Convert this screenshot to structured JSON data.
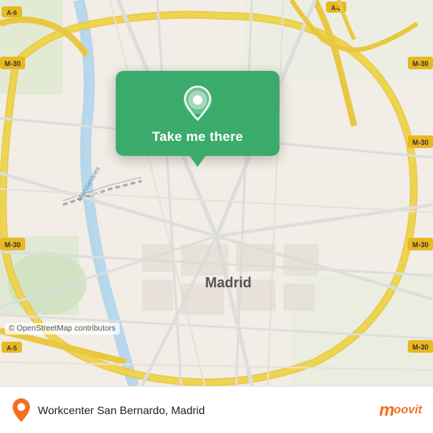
{
  "map": {
    "alt": "Map of Madrid",
    "osm_attribution": "© OpenStreetMap contributors",
    "center_label": "Madrid"
  },
  "popup": {
    "label": "Take me there",
    "pin_icon": "location-pin"
  },
  "bottom_bar": {
    "location_text": "Workcenter San Bernardo, Madrid",
    "logo_m": "m",
    "logo_rest": "oovit"
  }
}
